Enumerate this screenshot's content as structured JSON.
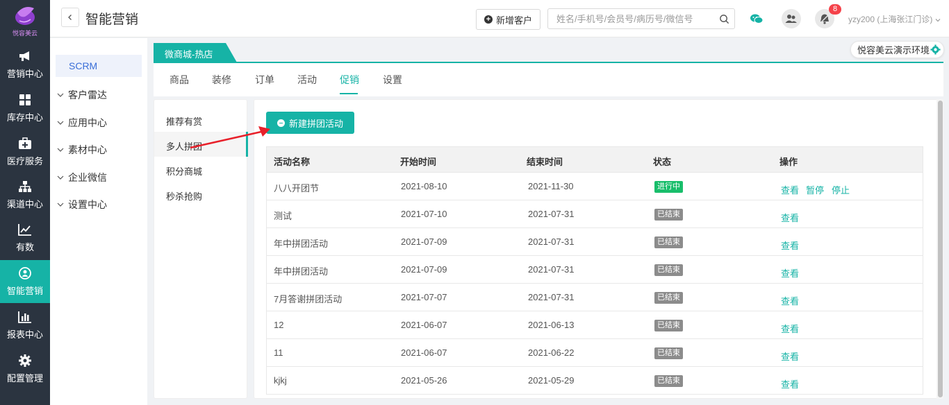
{
  "app": {
    "logo_text": "悦容美云",
    "title": "智能营销",
    "brand_color": "#16b3a6"
  },
  "rail": [
    {
      "label": "营销中心",
      "icon": "megaphone-icon"
    },
    {
      "label": "库存中心",
      "icon": "grid-icon"
    },
    {
      "label": "医疗服务",
      "icon": "medical-kit-icon"
    },
    {
      "label": "渠道中心",
      "icon": "org-chart-icon"
    },
    {
      "label": "有数",
      "icon": "trend-chart-icon"
    },
    {
      "label": "智能营销",
      "icon": "smart-marketing-icon",
      "active": true
    },
    {
      "label": "报表中心",
      "icon": "bar-chart-icon"
    },
    {
      "label": "配置管理",
      "icon": "gear-icon"
    }
  ],
  "header": {
    "back_icon": "chevron-left-icon",
    "new_customer": "新增客户",
    "search_placeholder": "姓名/手机号/会员号/病历号/微信号",
    "notification_count": "8",
    "user": "yzy200 (上海张江门诊)"
  },
  "submenu": {
    "active": "SCRM",
    "items": [
      "客户雷达",
      "应用中心",
      "素材中心",
      "企业微信",
      "设置中心"
    ]
  },
  "store_tab": "微商城-热店",
  "env_label": "悦容美云演示环境",
  "nav_tabs": [
    "商品",
    "装修",
    "订单",
    "活动",
    "促销",
    "设置"
  ],
  "nav_active": "促销",
  "promo_menu": [
    "推荐有赏",
    "多人拼团",
    "积分商城",
    "秒杀抢购"
  ],
  "promo_active": "多人拼团",
  "new_activity_button": "新建拼团活动",
  "table": {
    "columns": [
      "活动名称",
      "开始时间",
      "结束时间",
      "状态",
      "操作"
    ],
    "rows": [
      {
        "name": "八八开团节",
        "start": "2021-08-10",
        "end": "2021-11-30",
        "status": "进行中",
        "status_type": "running",
        "ops": [
          "查看",
          "暂停",
          "停止"
        ]
      },
      {
        "name": "测试",
        "start": "2021-07-10",
        "end": "2021-07-31",
        "status": "已结束",
        "status_type": "ended",
        "ops": [
          "查看"
        ]
      },
      {
        "name": "年中拼团活动",
        "start": "2021-07-09",
        "end": "2021-07-31",
        "status": "已结束",
        "status_type": "ended",
        "ops": [
          "查看"
        ]
      },
      {
        "name": "年中拼团活动",
        "start": "2021-07-09",
        "end": "2021-07-31",
        "status": "已结束",
        "status_type": "ended",
        "ops": [
          "查看"
        ]
      },
      {
        "name": "7月答谢拼团活动",
        "start": "2021-07-07",
        "end": "2021-07-31",
        "status": "已结束",
        "status_type": "ended",
        "ops": [
          "查看"
        ]
      },
      {
        "name": "12",
        "start": "2021-06-07",
        "end": "2021-06-13",
        "status": "已结束",
        "status_type": "ended",
        "ops": [
          "查看"
        ]
      },
      {
        "name": "11",
        "start": "2021-06-07",
        "end": "2021-06-22",
        "status": "已结束",
        "status_type": "ended",
        "ops": [
          "查看"
        ]
      },
      {
        "name": "kjkj",
        "start": "2021-05-26",
        "end": "2021-05-29",
        "status": "已结束",
        "status_type": "ended",
        "ops": [
          "查看"
        ]
      }
    ]
  }
}
